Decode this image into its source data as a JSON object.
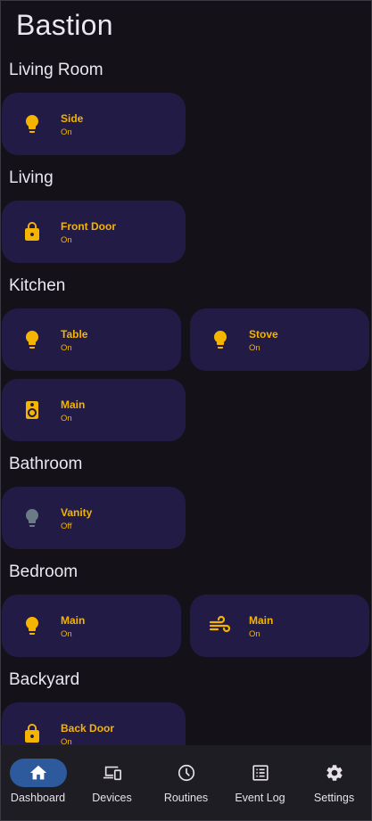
{
  "app": {
    "title": "Bastion"
  },
  "colors": {
    "accent": "#f4b400",
    "tile_bg": "#221b45",
    "off_icon": "#6a7a86",
    "nav_active": "#2d5a9c"
  },
  "rooms": [
    {
      "title": "Living Room",
      "devices": [
        {
          "name": "Side",
          "state": "On",
          "icon": "lightbulb-icon"
        }
      ]
    },
    {
      "title": "Living",
      "devices": [
        {
          "name": "Front Door",
          "state": "On",
          "icon": "lock-icon"
        }
      ]
    },
    {
      "title": "Kitchen",
      "devices": [
        {
          "name": "Table",
          "state": "On",
          "icon": "lightbulb-icon"
        },
        {
          "name": "Stove",
          "state": "On",
          "icon": "lightbulb-icon"
        },
        {
          "name": "Main",
          "state": "On",
          "icon": "speaker-icon"
        }
      ]
    },
    {
      "title": "Bathroom",
      "devices": [
        {
          "name": "Vanity",
          "state": "Off",
          "icon": "lightbulb-icon"
        }
      ]
    },
    {
      "title": "Bedroom",
      "devices": [
        {
          "name": "Main",
          "state": "On",
          "icon": "lightbulb-icon"
        },
        {
          "name": "Main",
          "state": "On",
          "icon": "fan-icon"
        }
      ]
    },
    {
      "title": "Backyard",
      "devices": [
        {
          "name": "Back Door",
          "state": "On",
          "icon": "lock-icon"
        }
      ]
    }
  ],
  "nav": {
    "items": [
      {
        "label": "Dashboard",
        "icon": "home-icon",
        "active": true
      },
      {
        "label": "Devices",
        "icon": "devices-icon"
      },
      {
        "label": "Routines",
        "icon": "clock-icon"
      },
      {
        "label": "Event Log",
        "icon": "list-icon"
      },
      {
        "label": "Settings",
        "icon": "gear-icon"
      }
    ]
  }
}
